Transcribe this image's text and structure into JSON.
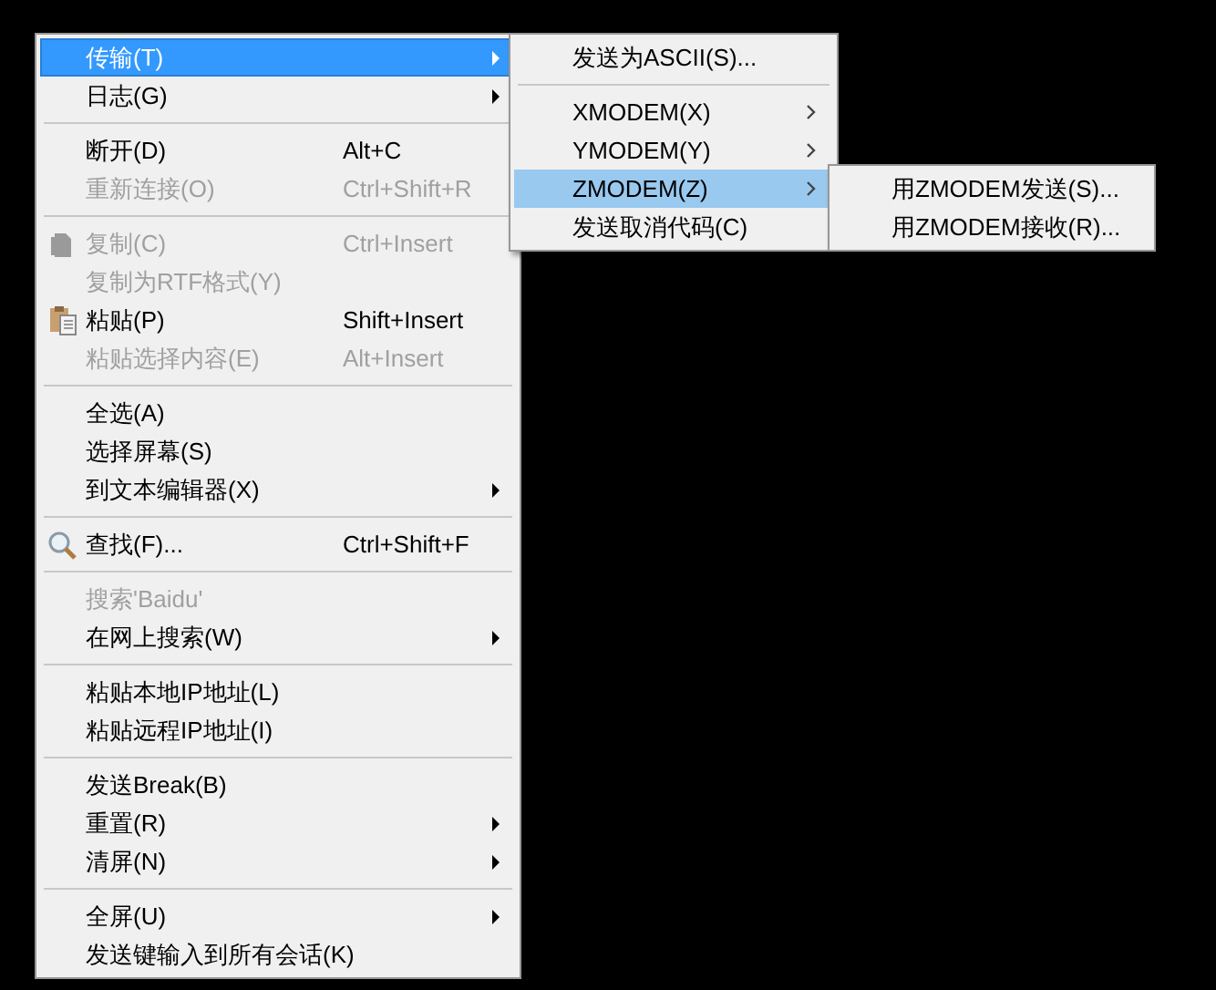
{
  "menu": {
    "items": [
      {
        "kind": "item",
        "label": "传输(T)",
        "submenu": true,
        "selected": true,
        "disabled": false
      },
      {
        "kind": "item",
        "label": "日志(G)",
        "submenu": true,
        "selected": false,
        "disabled": false
      },
      {
        "kind": "separator"
      },
      {
        "kind": "item",
        "label": "断开(D)",
        "shortcut": "Alt+C",
        "selected": false,
        "disabled": false
      },
      {
        "kind": "item",
        "label": "重新连接(O)",
        "shortcut": "Ctrl+Shift+R",
        "selected": false,
        "disabled": true
      },
      {
        "kind": "separator"
      },
      {
        "kind": "item",
        "label": "复制(C)",
        "shortcut": "Ctrl+Insert",
        "selected": false,
        "disabled": true
      },
      {
        "kind": "item",
        "label": "复制为RTF格式(Y)",
        "selected": false,
        "disabled": true
      },
      {
        "kind": "item",
        "label": "粘贴(P)",
        "shortcut": "Shift+Insert",
        "selected": false,
        "disabled": false
      },
      {
        "kind": "item",
        "label": "粘贴选择内容(E)",
        "shortcut": "Alt+Insert",
        "selected": false,
        "disabled": true
      },
      {
        "kind": "separator"
      },
      {
        "kind": "item",
        "label": "全选(A)",
        "selected": false,
        "disabled": false
      },
      {
        "kind": "item",
        "label": "选择屏幕(S)",
        "selected": false,
        "disabled": false
      },
      {
        "kind": "item",
        "label": "到文本编辑器(X)",
        "submenu": true,
        "selected": false,
        "disabled": false
      },
      {
        "kind": "separator"
      },
      {
        "kind": "item",
        "label": "查找(F)...",
        "shortcut": "Ctrl+Shift+F",
        "selected": false,
        "disabled": false
      },
      {
        "kind": "separator"
      },
      {
        "kind": "item",
        "label": "搜索'Baidu'",
        "selected": false,
        "disabled": true
      },
      {
        "kind": "item",
        "label": "在网上搜索(W)",
        "submenu": true,
        "selected": false,
        "disabled": false
      },
      {
        "kind": "separator"
      },
      {
        "kind": "item",
        "label": "粘贴本地IP地址(L)",
        "selected": false,
        "disabled": false
      },
      {
        "kind": "item",
        "label": "粘贴远程IP地址(I)",
        "selected": false,
        "disabled": false
      },
      {
        "kind": "separator"
      },
      {
        "kind": "item",
        "label": "发送Break(B)",
        "selected": false,
        "disabled": false
      },
      {
        "kind": "item",
        "label": "重置(R)",
        "submenu": true,
        "selected": false,
        "disabled": false
      },
      {
        "kind": "item",
        "label": "清屏(N)",
        "submenu": true,
        "selected": false,
        "disabled": false
      },
      {
        "kind": "separator"
      },
      {
        "kind": "item",
        "label": "全屏(U)",
        "submenu": true,
        "selected": false,
        "disabled": false
      },
      {
        "kind": "item",
        "label": "发送键输入到所有会话(K)",
        "selected": false,
        "disabled": false
      }
    ]
  },
  "transfer_submenu": {
    "items": [
      {
        "kind": "item",
        "label": "发送为ASCII(S)...",
        "selected": false
      },
      {
        "kind": "separator"
      },
      {
        "kind": "item",
        "label": "XMODEM(X)",
        "submenu": true,
        "selected": false
      },
      {
        "kind": "item",
        "label": "YMODEM(Y)",
        "submenu": true,
        "selected": false
      },
      {
        "kind": "item",
        "label": "ZMODEM(Z)",
        "submenu": true,
        "selected": true
      },
      {
        "kind": "item",
        "label": "发送取消代码(C)",
        "selected": false
      }
    ]
  },
  "zmodem_submenu": {
    "items": [
      {
        "kind": "item",
        "label": "用ZMODEM发送(S)...",
        "selected": false
      },
      {
        "kind": "item",
        "label": "用ZMODEM接收(R)...",
        "selected": false
      }
    ]
  }
}
